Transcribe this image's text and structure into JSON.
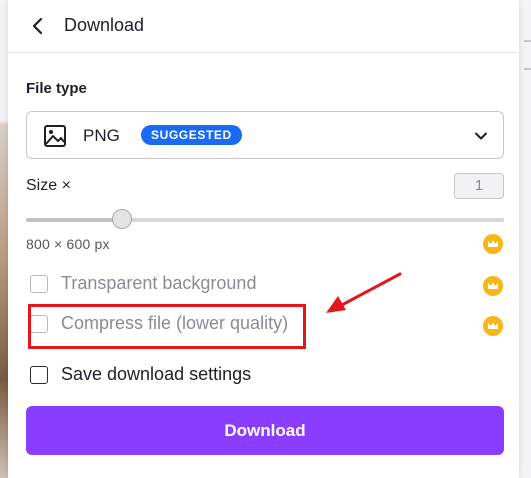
{
  "colors": {
    "brand_purple": "#8b3dff",
    "badge_blue": "#1b6bf2",
    "crown_gold": "#f5b616",
    "highlight_red": "#e4161d"
  },
  "header": {
    "back_icon": "chevron-left-icon",
    "title": "Download"
  },
  "file_type": {
    "label": "File type",
    "selected": "PNG",
    "selected_icon": "image-icon",
    "badge": "SUGGESTED",
    "dropdown_icon": "chevron-down-icon"
  },
  "size": {
    "label": "Size ×",
    "value": "1",
    "slider_fraction": 0.2,
    "dimensions": "800 × 600 px",
    "pro_icon": "crown-icon"
  },
  "options": [
    {
      "label": "Transparent background",
      "checked": false,
      "disabled": true,
      "pro_icon": "crown-icon"
    },
    {
      "label": "Compress file (lower quality)",
      "checked": false,
      "disabled": true,
      "pro_icon": "crown-icon"
    },
    {
      "label": "Save download settings",
      "checked": false,
      "disabled": false
    }
  ],
  "download_button": {
    "label": "Download"
  },
  "annotation": {
    "shape": "red-rectangle",
    "pointer": "red-arrow-icon"
  }
}
